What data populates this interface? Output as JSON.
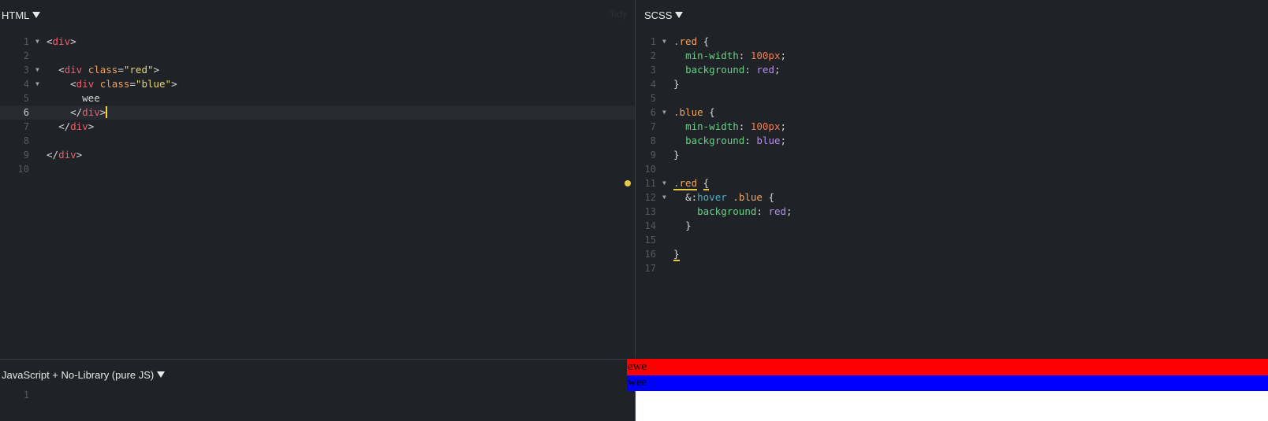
{
  "panes": {
    "html": {
      "title": "HTML",
      "tidy_label": "Tidy"
    },
    "scss": {
      "title": "SCSS"
    },
    "js": {
      "title": "JavaScript + No-Library (pure JS)"
    }
  },
  "html_code": {
    "line_numbers": [
      "1",
      "2",
      "3",
      "4",
      "5",
      "6",
      "7",
      "8",
      "9",
      "10"
    ],
    "class_red": "\"red\"",
    "class_blue": "\"blue\"",
    "content": "wee"
  },
  "scss_code": {
    "line_numbers": [
      "1",
      "2",
      "3",
      "4",
      "5",
      "6",
      "7",
      "8",
      "9",
      "10",
      "11",
      "12",
      "13",
      "14",
      "15",
      "16",
      "17"
    ],
    "sel_red": ".red",
    "sel_blue": ".blue",
    "prop_min_width": "min-width",
    "prop_background": "background",
    "val_100px": "100px",
    "val_red": "red",
    "val_blue": "blue",
    "pseudo_hover": "hover"
  },
  "js_code": {
    "line_numbers": [
      "1"
    ]
  },
  "result": {
    "red_text": "ewe",
    "blue_text": "wee"
  },
  "colors": {
    "red": "#ff0000",
    "blue": "#0000ff",
    "warning_dot": "#e6c84a"
  }
}
